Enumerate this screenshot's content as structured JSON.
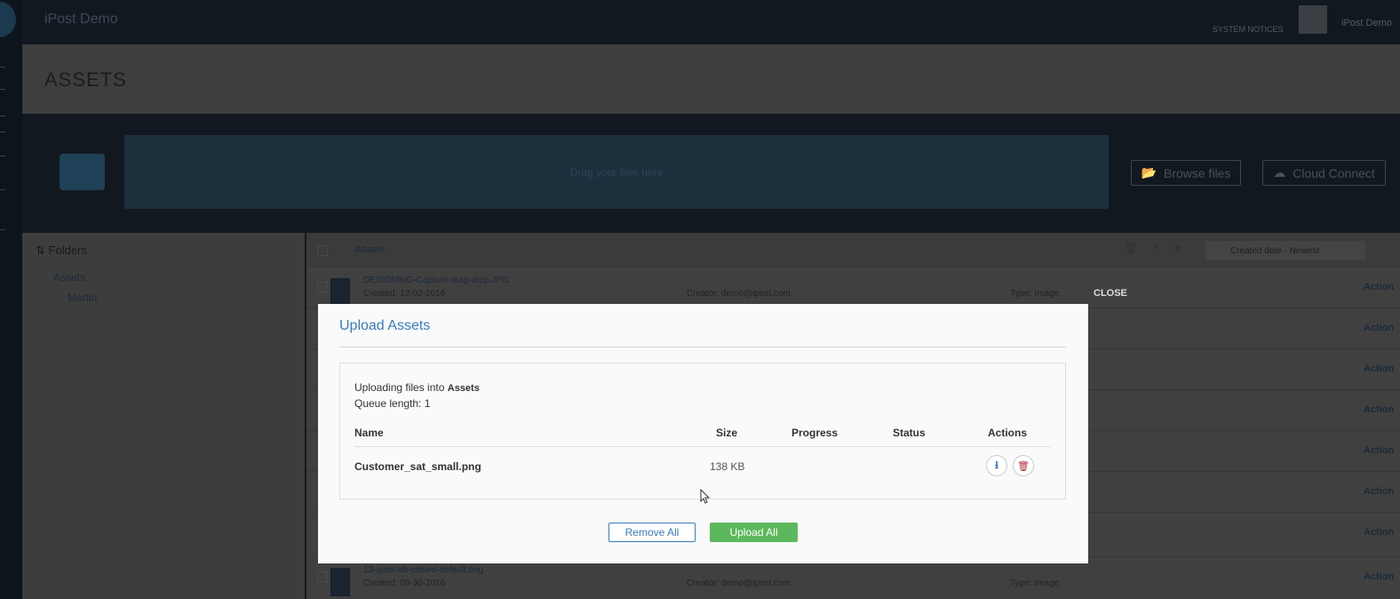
{
  "app": {
    "title": "iPost Demo",
    "system_notices": "SYSTEM NOTICES",
    "user": "iPost Demo"
  },
  "page": {
    "title": "ASSETS"
  },
  "upload": {
    "dropzone": "Drag your files here",
    "browse": "Browse files",
    "cloud": "Cloud Connect"
  },
  "folders": {
    "header": "Folders",
    "items": [
      {
        "label": "Assets"
      },
      {
        "label": "Martin"
      }
    ]
  },
  "list": {
    "breadcrumb": "Assets",
    "sort": "Created date - Newest",
    "rows": [
      {
        "name": "DESIGNING-Capture-drag-drop.JPG",
        "created": "Created: 12-02-2016",
        "creator": "Creator: demo@ipost.com",
        "type": "Type: Image",
        "action": "Action"
      },
      {
        "action": "Action"
      },
      {
        "action": "Action"
      },
      {
        "action": "Action"
      },
      {
        "action": "Action"
      },
      {
        "action": "Action"
      },
      {
        "action": "Action"
      },
      {
        "name": "13-ipost-ab-closed-default.png",
        "created": "Created: 09-30-2016",
        "creator": "Creator: demo@ipost.com",
        "type": "Type: Image",
        "action": "Action"
      }
    ]
  },
  "modal": {
    "close": "CLOSE",
    "title": "Upload Assets",
    "uploading_prefix": "Uploading files into",
    "folder": "Assets",
    "queue": "Queue length: 1",
    "columns": {
      "name": "Name",
      "size": "Size",
      "progress": "Progress",
      "status": "Status",
      "actions": "Actions"
    },
    "file": {
      "name": "Customer_sat_small.png",
      "size": "138 KB",
      "progress": "",
      "status": ""
    },
    "remove_all": "Remove All",
    "upload_all": "Upload All"
  },
  "colors": {
    "accent": "#3a7bbf",
    "success": "#5cb85c",
    "danger": "#b0303a"
  }
}
